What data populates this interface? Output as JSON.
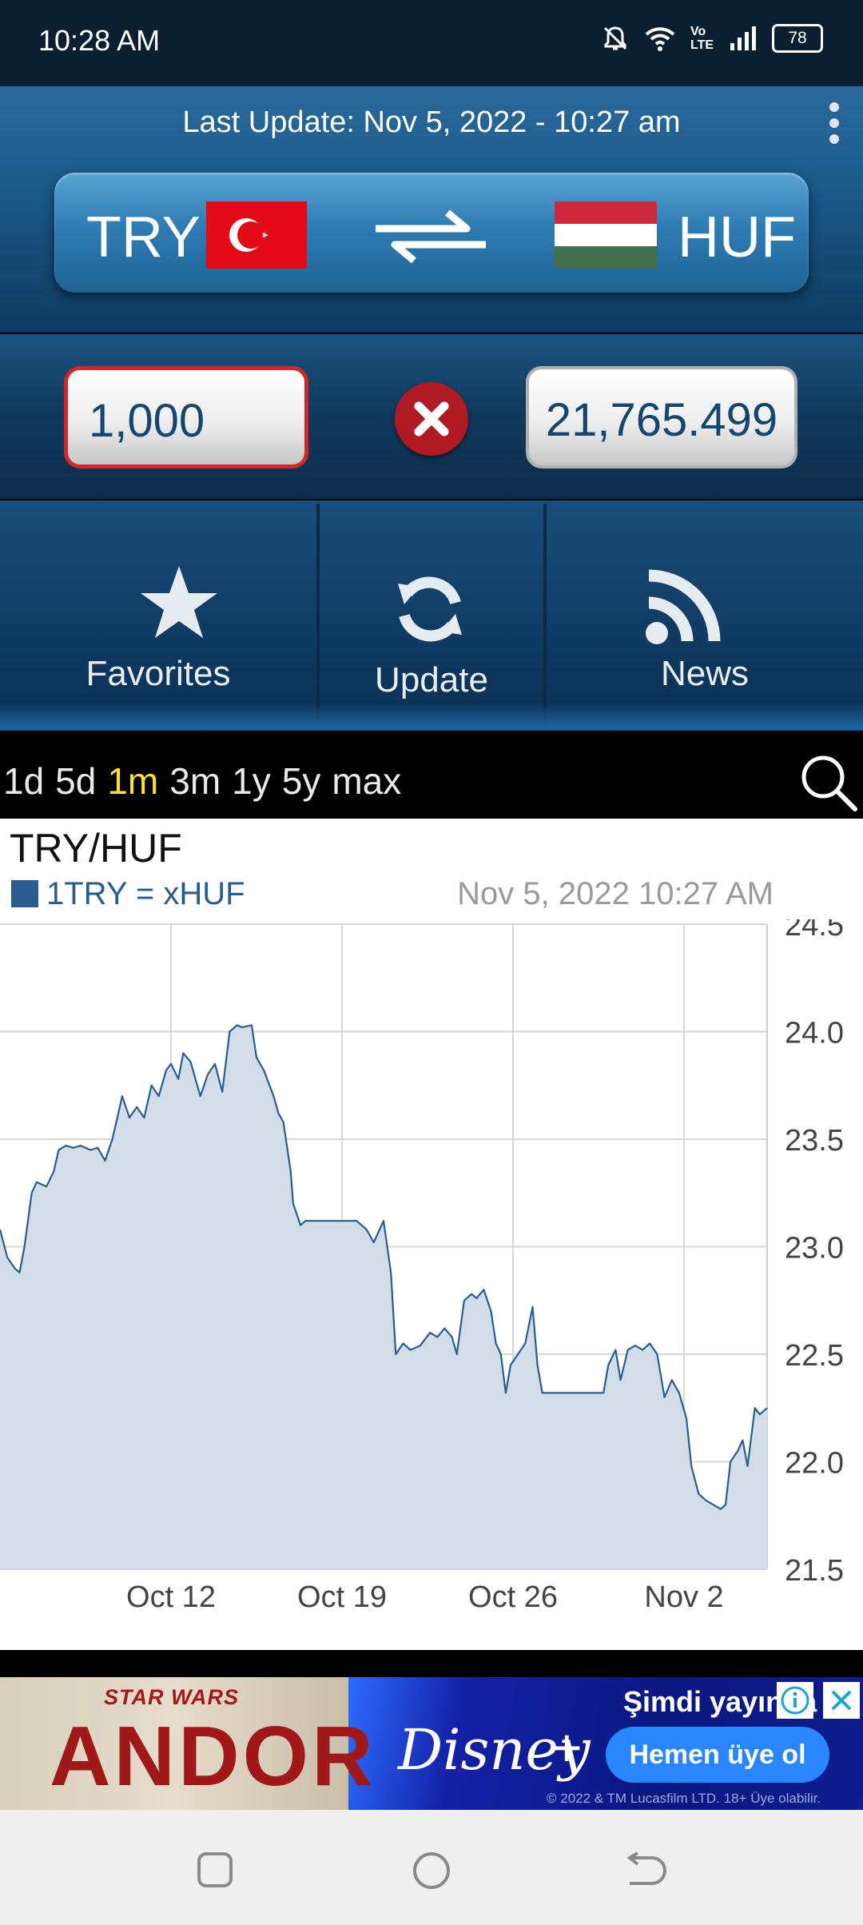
{
  "status_bar": {
    "time": "10:28 AM",
    "battery": "78",
    "network_label": "Vo LTE",
    "icons": [
      "mute-icon",
      "wifi-icon",
      "volte-icon",
      "signal-icon",
      "battery-icon"
    ]
  },
  "header": {
    "last_update": "Last Update: Nov 5, 2022 - 10:27 am",
    "from_code": "TRY",
    "to_code": "HUF",
    "from_flag": "turkey-flag",
    "to_flag": "hungary-flag"
  },
  "converter": {
    "amount": "1,000",
    "result": "21,765.499"
  },
  "nav": {
    "favorites": "Favorites",
    "update": "Update",
    "news": "News"
  },
  "ranges": {
    "items": [
      "1d",
      "5d",
      "1m",
      "3m",
      "1y",
      "5y",
      "max"
    ],
    "selected": "1m"
  },
  "chart": {
    "title": "TRY/HUF",
    "legend": "1TRY = xHUF",
    "timestamp": "Nov 5, 2022 10:27 AM"
  },
  "chart_data": {
    "type": "area",
    "title": "TRY/HUF",
    "series": [
      {
        "name": "1TRY = xHUF",
        "color": "#2a5d8f",
        "fill": "#d3dde7"
      }
    ],
    "x_tick_labels": [
      "Oct 12",
      "Oct 19",
      "Oct 26",
      "Nov 2"
    ],
    "x_ticks_day": [
      7,
      14,
      21,
      28
    ],
    "y_tick_labels": [
      "24.5",
      "24.0",
      "23.5",
      "23.0",
      "22.5",
      "22.0",
      "21.5"
    ],
    "ylim": [
      21.5,
      24.5
    ],
    "xlim_day": [
      0,
      31.4
    ],
    "grid": true,
    "y_axis_side": "right",
    "points": [
      [
        0.0,
        23.08
      ],
      [
        0.3,
        22.95
      ],
      [
        0.6,
        22.9
      ],
      [
        0.8,
        22.88
      ],
      [
        1.0,
        23.0
      ],
      [
        1.3,
        23.25
      ],
      [
        1.5,
        23.3
      ],
      [
        1.9,
        23.28
      ],
      [
        2.2,
        23.35
      ],
      [
        2.4,
        23.45
      ],
      [
        2.7,
        23.47
      ],
      [
        3.0,
        23.46
      ],
      [
        3.3,
        23.47
      ],
      [
        3.7,
        23.45
      ],
      [
        4.0,
        23.46
      ],
      [
        4.3,
        23.4
      ],
      [
        4.6,
        23.5
      ],
      [
        4.8,
        23.6
      ],
      [
        5.0,
        23.7
      ],
      [
        5.3,
        23.6
      ],
      [
        5.6,
        23.65
      ],
      [
        5.9,
        23.6
      ],
      [
        6.2,
        23.75
      ],
      [
        6.5,
        23.7
      ],
      [
        6.8,
        23.82
      ],
      [
        7.0,
        23.85
      ],
      [
        7.3,
        23.78
      ],
      [
        7.5,
        23.9
      ],
      [
        7.8,
        23.86
      ],
      [
        8.2,
        23.7
      ],
      [
        8.5,
        23.8
      ],
      [
        8.8,
        23.85
      ],
      [
        9.1,
        23.72
      ],
      [
        9.4,
        24.0
      ],
      [
        9.7,
        24.03
      ],
      [
        9.9,
        24.02
      ],
      [
        10.3,
        24.03
      ],
      [
        10.5,
        23.88
      ],
      [
        10.8,
        23.82
      ],
      [
        11.2,
        23.7
      ],
      [
        11.4,
        23.62
      ],
      [
        11.6,
        23.58
      ],
      [
        11.9,
        23.35
      ],
      [
        12.0,
        23.2
      ],
      [
        12.3,
        23.1
      ],
      [
        12.5,
        23.12
      ],
      [
        12.8,
        23.12
      ],
      [
        13.5,
        23.12
      ],
      [
        14.2,
        23.12
      ],
      [
        14.6,
        23.12
      ],
      [
        15.0,
        23.08
      ],
      [
        15.3,
        23.02
      ],
      [
        15.7,
        23.12
      ],
      [
        16.0,
        22.88
      ],
      [
        16.2,
        22.5
      ],
      [
        16.5,
        22.55
      ],
      [
        16.8,
        22.52
      ],
      [
        17.2,
        22.54
      ],
      [
        17.6,
        22.6
      ],
      [
        17.9,
        22.58
      ],
      [
        18.2,
        22.62
      ],
      [
        18.5,
        22.58
      ],
      [
        18.7,
        22.5
      ],
      [
        19.0,
        22.75
      ],
      [
        19.3,
        22.78
      ],
      [
        19.5,
        22.76
      ],
      [
        19.8,
        22.8
      ],
      [
        20.1,
        22.7
      ],
      [
        20.3,
        22.55
      ],
      [
        20.5,
        22.5
      ],
      [
        20.7,
        22.32
      ],
      [
        20.9,
        22.45
      ],
      [
        21.2,
        22.5
      ],
      [
        21.5,
        22.55
      ],
      [
        21.8,
        22.72
      ],
      [
        22.0,
        22.45
      ],
      [
        22.2,
        22.32
      ],
      [
        22.5,
        22.32
      ],
      [
        22.8,
        22.32
      ],
      [
        23.5,
        22.32
      ],
      [
        24.2,
        22.32
      ],
      [
        24.7,
        22.32
      ],
      [
        24.9,
        22.45
      ],
      [
        25.2,
        22.52
      ],
      [
        25.4,
        22.38
      ],
      [
        25.7,
        22.52
      ],
      [
        26.0,
        22.54
      ],
      [
        26.3,
        22.52
      ],
      [
        26.6,
        22.55
      ],
      [
        26.9,
        22.5
      ],
      [
        27.2,
        22.3
      ],
      [
        27.5,
        22.38
      ],
      [
        27.8,
        22.32
      ],
      [
        28.1,
        22.2
      ],
      [
        28.3,
        21.98
      ],
      [
        28.6,
        21.85
      ],
      [
        28.9,
        21.82
      ],
      [
        29.2,
        21.8
      ],
      [
        29.5,
        21.78
      ],
      [
        29.7,
        21.8
      ],
      [
        29.9,
        22.0
      ],
      [
        30.2,
        22.05
      ],
      [
        30.4,
        22.1
      ],
      [
        30.6,
        21.98
      ],
      [
        30.9,
        22.25
      ],
      [
        31.1,
        22.22
      ],
      [
        31.4,
        22.25
      ]
    ]
  },
  "ad": {
    "brand_small": "STAR WARS",
    "brand_big": "ANDOR",
    "service": "Disney",
    "service_plus": "+",
    "headline": "Şimdi yayında",
    "cta": "Hemen üye ol",
    "legal": "© 2022 & TM Lucasfilm LTD. 18+ Üye olabilir."
  }
}
